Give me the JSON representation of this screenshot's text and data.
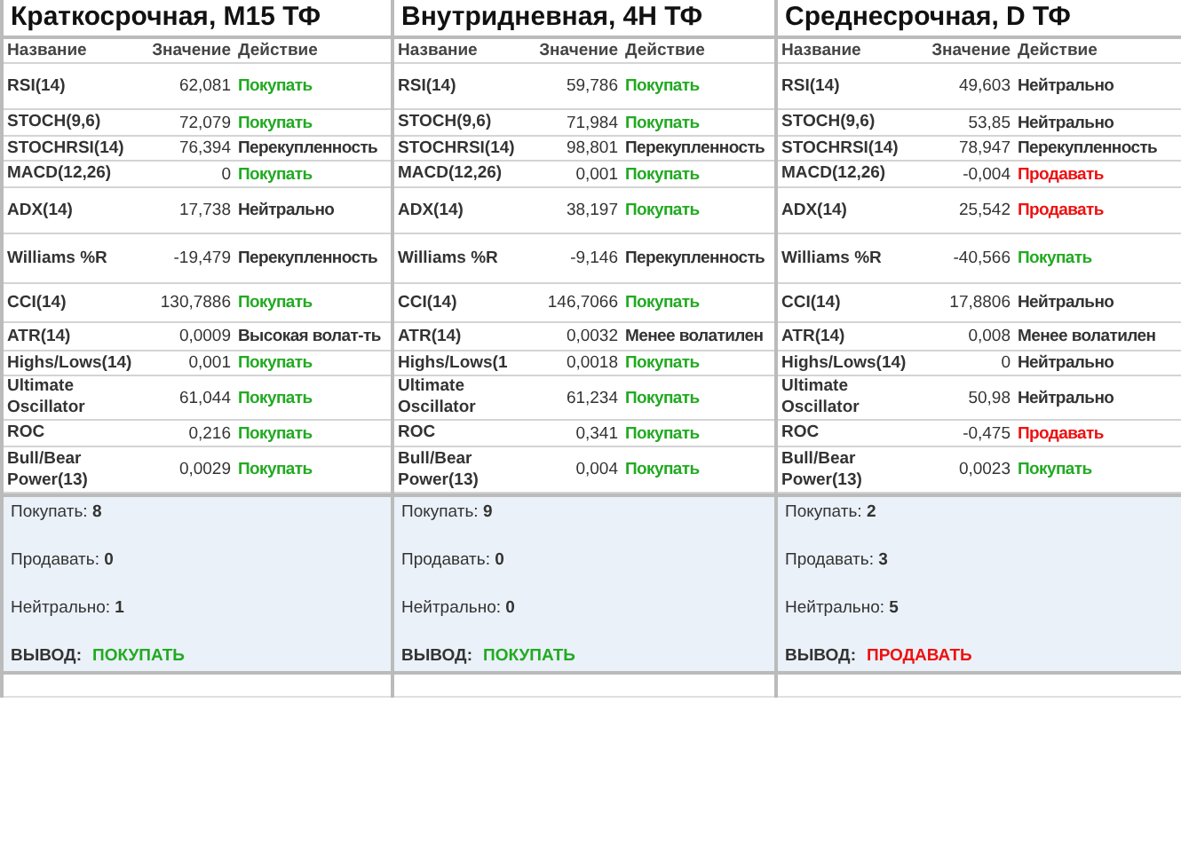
{
  "panels": [
    {
      "title": "Краткосрочная, M15 ТФ",
      "columns": [
        "Название",
        "Значение",
        "Действие"
      ],
      "rows": [
        {
          "name": "RSI(14)",
          "value": "62,081",
          "action": "Покупать",
          "kind": "buy"
        },
        {
          "name": "STOCH(9,6)",
          "value": "72,079",
          "action": "Покупать",
          "kind": "buy"
        },
        {
          "name": "STOCHRSI(14)",
          "value": "76,394",
          "action": "Перекупленность",
          "kind": "neutral"
        },
        {
          "name": "MACD(12,26)",
          "value": "0",
          "action": "Покупать",
          "kind": "buy"
        },
        {
          "name": "ADX(14)",
          "value": "17,738",
          "action": "Нейтрально",
          "kind": "neutral"
        },
        {
          "name": "Williams %R",
          "value": "-19,479",
          "action": "Перекупленность",
          "kind": "neutral"
        },
        {
          "name": "CCI(14)",
          "value": "130,7886",
          "action": "Покупать",
          "kind": "buy"
        },
        {
          "name": "ATR(14)",
          "value": "0,0009",
          "action": "Высокая волат-ть",
          "kind": "neutral"
        },
        {
          "name": "Highs/Lows(14)",
          "value": "0,001",
          "action": "Покупать",
          "kind": "buy"
        },
        {
          "name": "Ultimate Oscillator",
          "value": "61,044",
          "action": "Покупать",
          "kind": "buy"
        },
        {
          "name": "ROC",
          "value": "0,216",
          "action": "Покупать",
          "kind": "buy"
        },
        {
          "name": "Bull/Bear Power(13)",
          "value": "0,0029",
          "action": "Покупать",
          "kind": "buy"
        }
      ],
      "summary": [
        {
          "label": "Покупать:",
          "count": "8"
        },
        {
          "label": "Продавать:",
          "count": "0"
        },
        {
          "label": "Нейтрально:",
          "count": "1"
        }
      ],
      "verdict": {
        "label": "ВЫВОД:",
        "value": "ПОКУПАТЬ",
        "kind": "buy"
      }
    },
    {
      "title": "Внутридневная, 4H ТФ",
      "columns": [
        "Название",
        "Значение",
        "Действие"
      ],
      "rows": [
        {
          "name": "RSI(14)",
          "value": "59,786",
          "action": "Покупать",
          "kind": "buy"
        },
        {
          "name": "STOCH(9,6)",
          "value": "71,984",
          "action": "Покупать",
          "kind": "buy"
        },
        {
          "name": "STOCHRSI(14)",
          "value": "98,801",
          "action": "Перекупленность",
          "kind": "neutral"
        },
        {
          "name": "MACD(12,26)",
          "value": "0,001",
          "action": "Покупать",
          "kind": "buy"
        },
        {
          "name": "ADX(14)",
          "value": "38,197",
          "action": "Покупать",
          "kind": "buy"
        },
        {
          "name": "Williams %R",
          "value": "-9,146",
          "action": "Перекупленность",
          "kind": "neutral"
        },
        {
          "name": "CCI(14)",
          "value": "146,7066",
          "action": "Покупать",
          "kind": "buy"
        },
        {
          "name": "ATR(14)",
          "value": "0,0032",
          "action": "Менее волатилен",
          "kind": "neutral"
        },
        {
          "name": "Highs/Lows(1",
          "value": "0,0018",
          "action": "Покупать",
          "kind": "buy"
        },
        {
          "name": "Ultimate Oscillator",
          "value": "61,234",
          "action": "Покупать",
          "kind": "buy"
        },
        {
          "name": "ROC",
          "value": "0,341",
          "action": "Покупать",
          "kind": "buy"
        },
        {
          "name": "Bull/Bear Power(13)",
          "value": "0,004",
          "action": "Покупать",
          "kind": "buy"
        }
      ],
      "summary": [
        {
          "label": "Покупать:",
          "count": "9"
        },
        {
          "label": "Продавать:",
          "count": "0"
        },
        {
          "label": "Нейтрально:",
          "count": "0"
        }
      ],
      "verdict": {
        "label": "ВЫВОД:",
        "value": "ПОКУПАТЬ",
        "kind": "buy"
      }
    },
    {
      "title": "Среднесрочная, D ТФ",
      "columns": [
        "Название",
        "Значение",
        "Действие"
      ],
      "rows": [
        {
          "name": "RSI(14)",
          "value": "49,603",
          "action": "Нейтрально",
          "kind": "neutral"
        },
        {
          "name": "STOCH(9,6)",
          "value": "53,85",
          "action": "Нейтрально",
          "kind": "neutral"
        },
        {
          "name": "STOCHRSI(14)",
          "value": "78,947",
          "action": "Перекупленность",
          "kind": "neutral"
        },
        {
          "name": "MACD(12,26)",
          "value": "-0,004",
          "action": "Продавать",
          "kind": "sell"
        },
        {
          "name": "ADX(14)",
          "value": "25,542",
          "action": "Продавать",
          "kind": "sell"
        },
        {
          "name": "Williams %R",
          "value": "-40,566",
          "action": "Покупать",
          "kind": "buy"
        },
        {
          "name": "CCI(14)",
          "value": "17,8806",
          "action": "Нейтрально",
          "kind": "neutral"
        },
        {
          "name": "ATR(14)",
          "value": "0,008",
          "action": "Менее волатилен",
          "kind": "neutral"
        },
        {
          "name": "Highs/Lows(14)",
          "value": "0",
          "action": "Нейтрально",
          "kind": "neutral"
        },
        {
          "name": "Ultimate Oscillator",
          "value": "50,98",
          "action": "Нейтрально",
          "kind": "neutral"
        },
        {
          "name": "ROC",
          "value": "-0,475",
          "action": "Продавать",
          "kind": "sell"
        },
        {
          "name": "Bull/Bear Power(13)",
          "value": "0,0023",
          "action": "Покупать",
          "kind": "buy"
        }
      ],
      "summary": [
        {
          "label": "Покупать:",
          "count": "2"
        },
        {
          "label": "Продавать:",
          "count": "3"
        },
        {
          "label": "Нейтрально:",
          "count": "5"
        }
      ],
      "verdict": {
        "label": "ВЫВОД:",
        "value": "ПРОДАВАТЬ",
        "kind": "sell"
      }
    }
  ]
}
